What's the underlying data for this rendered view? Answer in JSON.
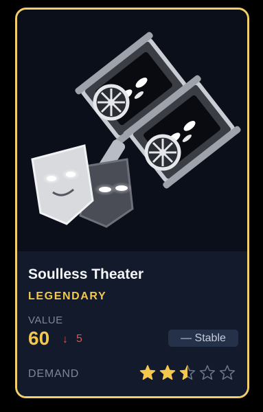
{
  "item": {
    "name": "Soulless Theater",
    "rarity": "LEGENDARY",
    "value_label": "VALUE",
    "value": "60",
    "change_symbol": "↓",
    "change_value": "5",
    "trend_label": "— Stable",
    "demand_label": "DEMAND",
    "demand_rating": 2.5,
    "demand_max": 5
  },
  "colors": {
    "border": "#f2cf6b",
    "accent_gold": "#f3c84d",
    "down_red": "#e05252",
    "star_filled": "#f3c84d",
    "star_empty": "#6b7487"
  },
  "icons": {
    "change": "arrow-down-icon",
    "star": "star-icon",
    "art": "soulless-theater-art"
  }
}
